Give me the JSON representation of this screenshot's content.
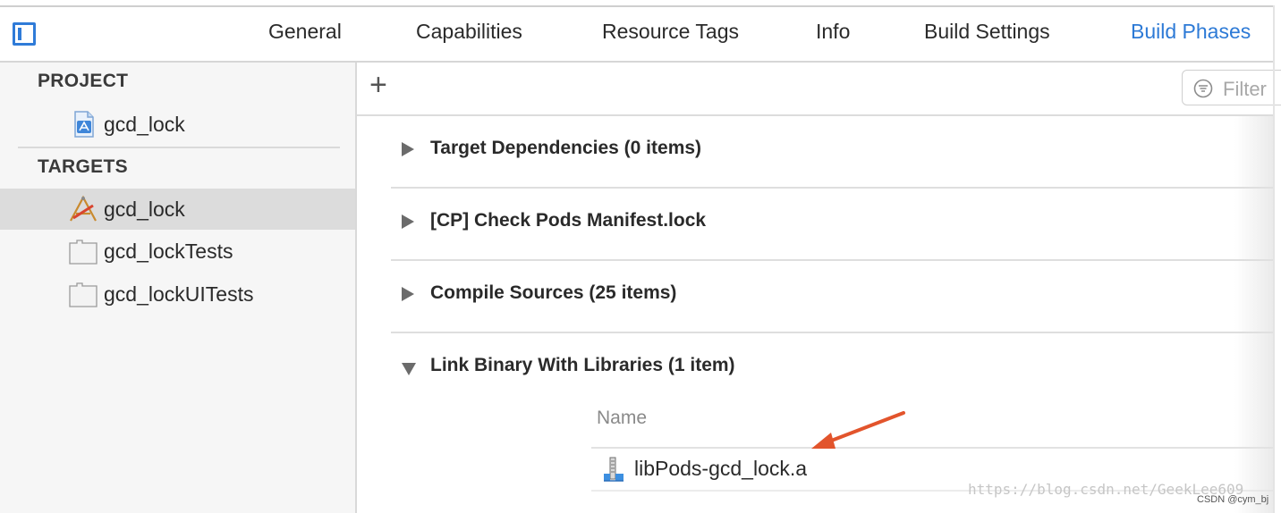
{
  "tabs": [
    {
      "label": "General"
    },
    {
      "label": "Capabilities"
    },
    {
      "label": "Resource Tags"
    },
    {
      "label": "Info"
    },
    {
      "label": "Build Settings"
    },
    {
      "label": "Build Phases",
      "active": true
    }
  ],
  "sidebar": {
    "project_heading": "PROJECT",
    "project_item": {
      "label": "gcd_lock",
      "icon": "xcode-project-icon"
    },
    "targets_heading": "TARGETS",
    "targets": [
      {
        "label": "gcd_lock",
        "icon": "app-target-icon",
        "selected": true
      },
      {
        "label": "gcd_lockTests",
        "icon": "test-bundle-icon"
      },
      {
        "label": "gcd_lockUITests",
        "icon": "test-bundle-icon"
      }
    ]
  },
  "toolbar": {
    "add_symbol": "+",
    "filter_placeholder": "Filter"
  },
  "phases": [
    {
      "title": "Target Dependencies (0 items)",
      "expanded": false
    },
    {
      "title": "[CP] Check Pods Manifest.lock",
      "expanded": false
    },
    {
      "title": "Compile Sources (25 items)",
      "expanded": false
    },
    {
      "title": "Link Binary With Libraries (1 item)",
      "expanded": true
    }
  ],
  "libraries": {
    "column_header": "Name",
    "items": [
      {
        "name": "libPods-gcd_lock.a",
        "icon": "static-library-icon"
      }
    ]
  },
  "annotation": {
    "arrow_color": "#e2542c"
  },
  "colors": {
    "accent": "#2d7ad6",
    "selection": "#dcdcdc"
  },
  "watermark": {
    "url": "https://blog.csdn.net/GeekLee609",
    "credit": "CSDN @cym_bj"
  }
}
